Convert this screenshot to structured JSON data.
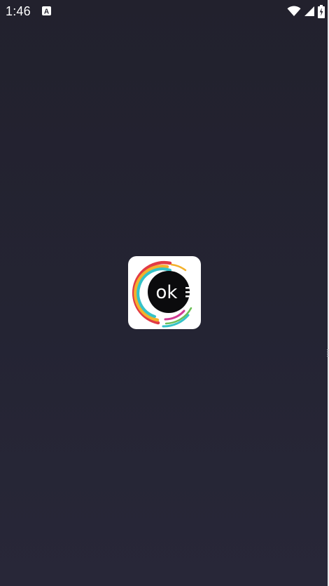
{
  "status_bar": {
    "time": "1:46",
    "notification_icon": "text-a-icon",
    "wifi_icon": "wifi-icon",
    "signal_icon": "signal-icon",
    "battery_icon": "battery-charging-icon"
  },
  "splash": {
    "logo_text": "ok",
    "logo_icon": "app-logo-icon"
  },
  "colors": {
    "background": "#23222f",
    "logo_ring_red": "#e23b45",
    "logo_ring_yellow": "#f3b12b",
    "logo_ring_cyan": "#35c3c8",
    "logo_ring_pink": "#d03a92",
    "logo_ring_green": "#6bbf56"
  }
}
